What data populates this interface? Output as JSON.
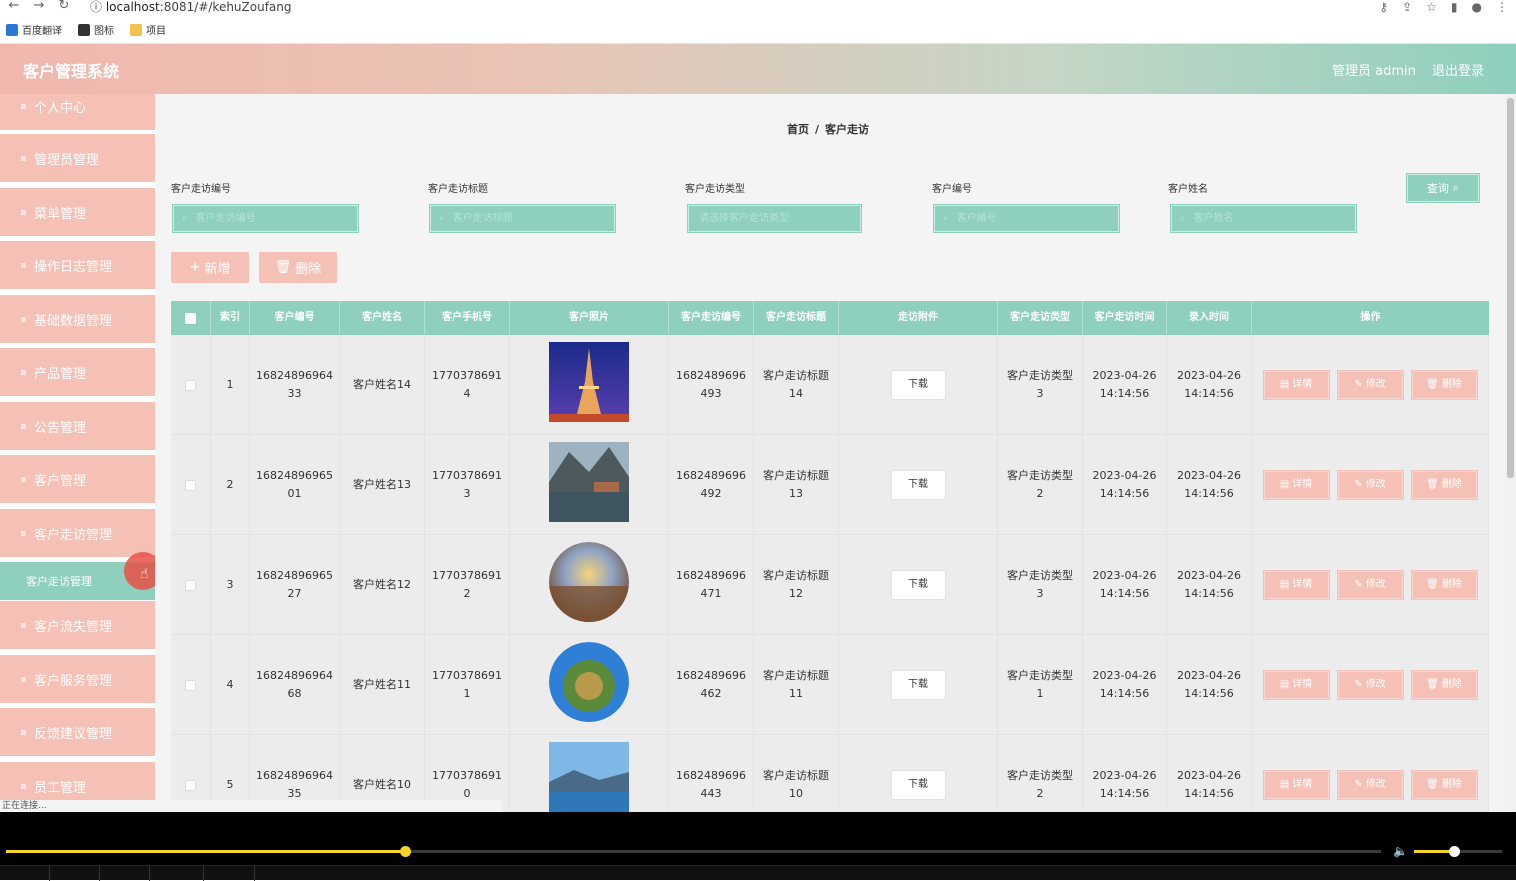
{
  "browser": {
    "url_host": "localhost",
    "url_rest": ":8081/#/kehuZoufang",
    "bookmarks": [
      {
        "label": "百度翻译",
        "icon": "translate-icon",
        "color": "#2a78d6"
      },
      {
        "label": "图标",
        "icon": "image-icon",
        "color": "#333333"
      },
      {
        "label": "项目",
        "icon": "folder-icon",
        "color": "#f2c14e"
      }
    ]
  },
  "header": {
    "brand": "客户管理系统",
    "user": "管理员 admin",
    "logout": "退出登录"
  },
  "sidebar": {
    "items": [
      {
        "label": "个人中心"
      },
      {
        "label": "管理员管理"
      },
      {
        "label": "菜单管理"
      },
      {
        "label": "操作日志管理"
      },
      {
        "label": "基础数据管理"
      },
      {
        "label": "产品管理"
      },
      {
        "label": "公告管理"
      },
      {
        "label": "客户管理"
      },
      {
        "label": "客户走访管理"
      },
      {
        "label": "客户流失管理"
      },
      {
        "label": "客户服务管理"
      },
      {
        "label": "反馈建议管理"
      },
      {
        "label": "员工管理"
      }
    ],
    "active_sub": "客户走访管理"
  },
  "breadcrumb": {
    "home": "首页",
    "sep": "/",
    "current": "客户走访"
  },
  "filters": [
    {
      "label": "客户走访编号",
      "placeholder": "客户走访编号"
    },
    {
      "label": "客户走访标题",
      "placeholder": "客户走访标题"
    },
    {
      "label": "客户走访类型",
      "placeholder": "请选择客户走访类型"
    },
    {
      "label": "客户编号",
      "placeholder": "客户编号"
    },
    {
      "label": "客户姓名",
      "placeholder": "客户姓名"
    }
  ],
  "buttons": {
    "query": "查询",
    "add": "新增",
    "delete": "删除"
  },
  "table": {
    "headers": [
      "索引",
      "客户编号",
      "客户姓名",
      "客户手机号",
      "客户照片",
      "客户走访编号",
      "客户走访标题",
      "走访附件",
      "客户走访类型",
      "客户走访时间",
      "录入时间",
      "操作"
    ],
    "download_label": "下载",
    "op_detail": "详情",
    "op_edit": "修改",
    "op_delete": "删除",
    "rows": [
      {
        "index": "1",
        "kh_no_a": "16824896964",
        "kh_no_b": "33",
        "name": "客户姓名14",
        "phone_a": "1770378691",
        "phone_b": "4",
        "photo": "eiffel-tower",
        "zf_no_a": "1682489696",
        "zf_no_b": "493",
        "title_a": "客户走访标题",
        "title_b": "14",
        "type_a": "客户走访类型",
        "type_b": "3",
        "zf_date": "2023-04-26",
        "zf_time": "14:14:56",
        "in_date": "2023-04-26",
        "in_time": "14:14:56"
      },
      {
        "index": "2",
        "kh_no_a": "16824896965",
        "kh_no_b": "01",
        "name": "客户姓名13",
        "phone_a": "1770378691",
        "phone_b": "3",
        "photo": "lake-village",
        "zf_no_a": "1682489696",
        "zf_no_b": "492",
        "title_a": "客户走访标题",
        "title_b": "13",
        "type_a": "客户走访类型",
        "type_b": "2",
        "zf_date": "2023-04-26",
        "zf_time": "14:14:56",
        "in_date": "2023-04-26",
        "in_time": "14:14:56"
      },
      {
        "index": "3",
        "kh_no_a": "16824896965",
        "kh_no_b": "27",
        "name": "客户姓名12",
        "phone_a": "1770378691",
        "phone_b": "2",
        "photo": "sunset-planet",
        "zf_no_a": "1682489696",
        "zf_no_b": "471",
        "title_a": "客户走访标题",
        "title_b": "12",
        "type_a": "客户走访类型",
        "type_b": "3",
        "zf_date": "2023-04-26",
        "zf_time": "14:14:56",
        "in_date": "2023-04-26",
        "in_time": "14:14:56"
      },
      {
        "index": "4",
        "kh_no_a": "16824896964",
        "kh_no_b": "68",
        "name": "客户姓名11",
        "phone_a": "1770378691",
        "phone_b": "1",
        "photo": "green-planet",
        "zf_no_a": "1682489696",
        "zf_no_b": "462",
        "title_a": "客户走访标题",
        "title_b": "11",
        "type_a": "客户走访类型",
        "type_b": "1",
        "zf_date": "2023-04-26",
        "zf_time": "14:14:56",
        "in_date": "2023-04-26",
        "in_time": "14:14:56"
      },
      {
        "index": "5",
        "kh_no_a": "16824896964",
        "kh_no_b": "35",
        "name": "客户姓名10",
        "phone_a": "1770378691",
        "phone_b": "0",
        "photo": "blue-lake",
        "zf_no_a": "1682489696",
        "zf_no_b": "443",
        "title_a": "客户走访标题",
        "title_b": "10",
        "type_a": "客户走访类型",
        "type_b": "2",
        "zf_date": "2023-04-26",
        "zf_time": "14:14:56",
        "in_date": "2023-04-26",
        "in_time": "14:14:56"
      }
    ]
  },
  "status_bar": "正在连接...",
  "player": {
    "seek_progress": 0.29,
    "volume_level": 0.45
  },
  "colors": {
    "accent": "#8ecfbd",
    "pink": "#f5c0b5"
  }
}
